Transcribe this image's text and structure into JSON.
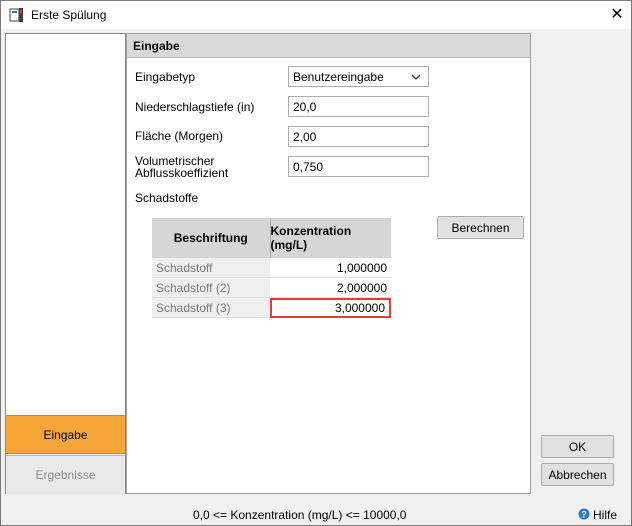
{
  "window": {
    "title": "Erste Spülung",
    "close": "✕"
  },
  "sidebar": {
    "items": [
      {
        "label": "Eingabe"
      },
      {
        "label": "Ergebnisse"
      }
    ]
  },
  "panel": {
    "header": "Eingabe",
    "fields": {
      "input_type": {
        "label": "Eingabetyp",
        "value": "Benutzereingabe"
      },
      "depth": {
        "label": "Niederschlagstiefe (in)",
        "value": "20,0"
      },
      "area": {
        "label": "Fläche (Morgen)",
        "value": "2,00"
      },
      "coeff": {
        "label_line1": "Volumetrischer",
        "label_line2": "Abflusskoeffizient",
        "value": "0,750"
      }
    },
    "pollutants_label": "Schadstoffe",
    "compute_label": "Berechnen",
    "table": {
      "columns": [
        "Beschriftung",
        "Konzentration (mg/L)"
      ],
      "rows": [
        {
          "name": "Schadstoff",
          "value": "1,000000"
        },
        {
          "name": "Schadstoff (2)",
          "value": "2,000000"
        },
        {
          "name": "Schadstoff (3)",
          "value": "3,000000"
        }
      ]
    }
  },
  "buttons": {
    "ok": "OK",
    "cancel": "Abbrechen"
  },
  "status": {
    "text": "0,0 <= Konzentration (mg/L) <= 10000,0",
    "help": "Hilfe"
  },
  "colors": {
    "accent": "#f6a637",
    "selection_border": "#e23b3b",
    "help_icon": "#2b78d4"
  }
}
